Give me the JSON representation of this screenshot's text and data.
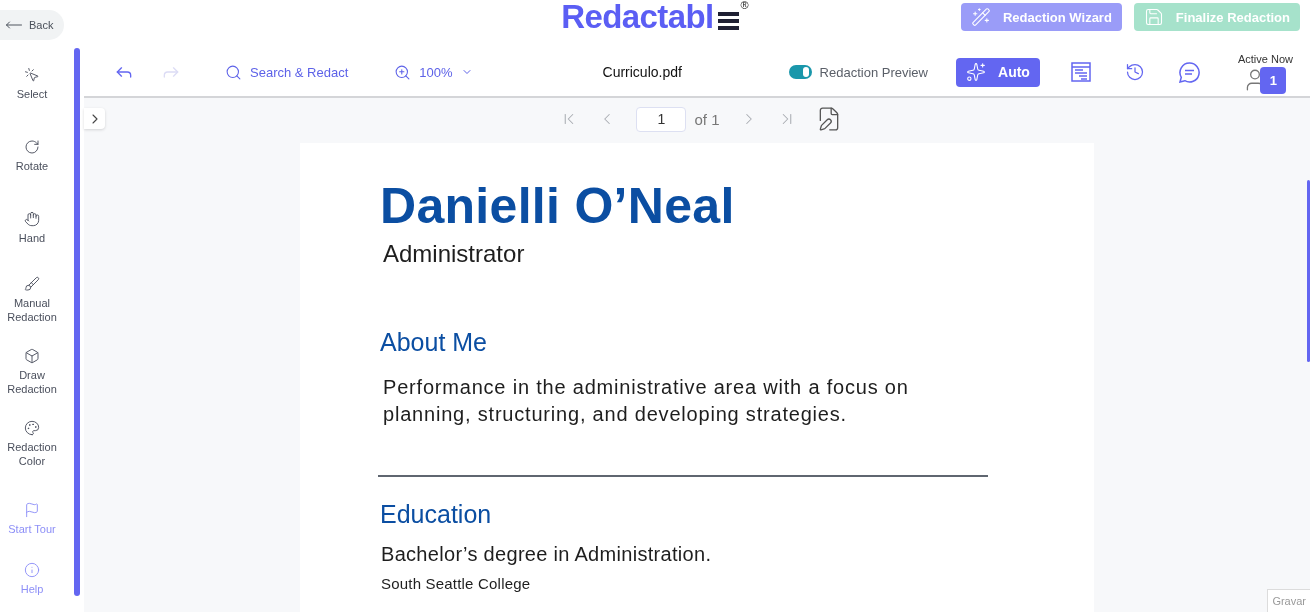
{
  "header": {
    "back": "Back",
    "logo": {
      "text": "Redactabl",
      "mark": "®"
    },
    "buttons": [
      {
        "kind": "wizard",
        "label": "Redaction Wizard",
        "disabled": true
      },
      {
        "kind": "finalize",
        "label": "Finalize Redaction",
        "disabled": true
      }
    ]
  },
  "tools": [
    {
      "kind": "select",
      "label": "Select"
    },
    {
      "kind": "rotate",
      "label": "Rotate"
    },
    {
      "kind": "hand",
      "label": "Hand"
    },
    {
      "kind": "manual",
      "label": "Manual Redaction"
    },
    {
      "kind": "draw",
      "label": "Draw Redaction"
    },
    {
      "kind": "color",
      "label": "Redaction Color"
    }
  ],
  "guide_links": [
    {
      "kind": "tour",
      "label": "Start Tour"
    },
    {
      "kind": "help",
      "label": "Help"
    }
  ],
  "toolbar": {
    "history": [
      {
        "kind": "undo",
        "disabled": false
      },
      {
        "kind": "redo",
        "disabled": true
      }
    ],
    "search": "Search & Redact",
    "zoom": "100%",
    "file_name": "Curriculo.pdf",
    "preview": {
      "label": "Redaction Preview",
      "on": true
    },
    "auto": "Auto",
    "panels": [
      {
        "kind": "document"
      },
      {
        "kind": "history"
      },
      {
        "kind": "comments"
      }
    ],
    "active_now": {
      "label": "Active Now",
      "count": "1"
    }
  },
  "pager": {
    "page": "1",
    "total": "of 1",
    "buttons": [
      {
        "kind": "first",
        "disabled": true
      },
      {
        "kind": "previous",
        "disabled": true
      },
      {
        "kind": "next",
        "disabled": true
      },
      {
        "kind": "last",
        "disabled": true
      }
    ]
  },
  "document": {
    "name": "Danielli O’Neal",
    "role": "Administrator",
    "blocks": [
      {
        "kind": "heading",
        "text": "About Me"
      },
      {
        "kind": "paragraph",
        "text": "Performance in the administrative area with a focus on planning, structuring, and developing strategies."
      },
      {
        "kind": "divider"
      },
      {
        "kind": "heading",
        "text": "Education"
      },
      {
        "kind": "degree",
        "text": "Bachelor’s degree in Administration."
      },
      {
        "kind": "school",
        "text": "South Seattle College"
      }
    ]
  },
  "recorder": {
    "label": "Gravar"
  }
}
